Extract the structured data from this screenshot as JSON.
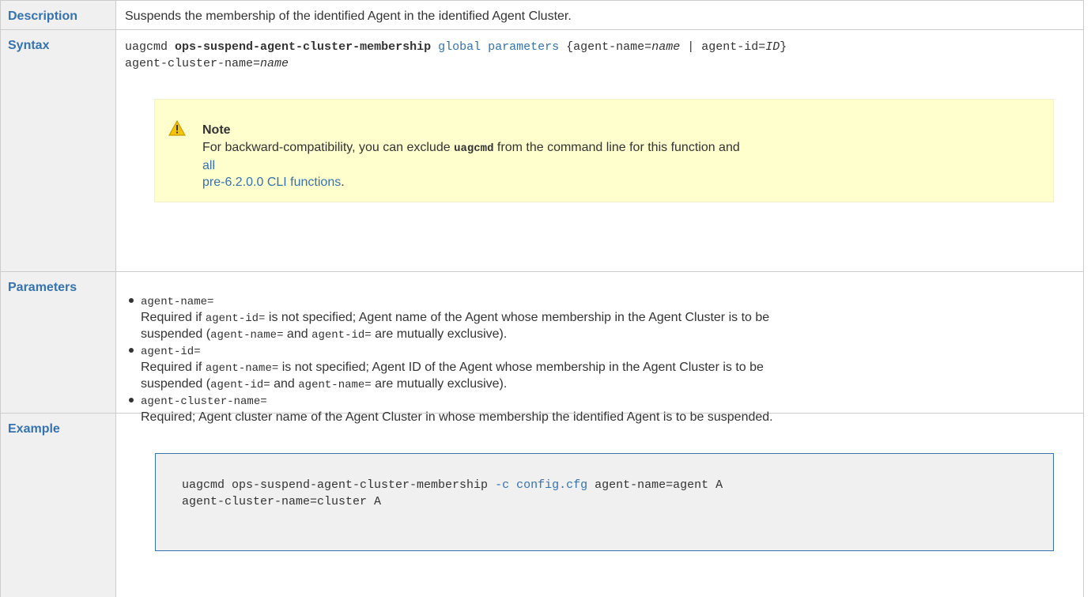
{
  "labels": {
    "description": "Description",
    "syntax": "Syntax",
    "parameters": "Parameters",
    "example": "Example"
  },
  "description": "Suspends the membership of the identified Agent in the identified Agent Cluster.",
  "syntax": {
    "cmd": "uagcmd",
    "function": "ops-suspend-agent-cluster-membership",
    "global_link": "global parameters",
    "brace_open": "{agent-name=",
    "name_italic": "name",
    "pipe": " | agent-id=",
    "id_italic": "ID",
    "brace_close": "}",
    "line2_prefix": "agent-cluster-name=",
    "line2_italic": "name"
  },
  "note": {
    "title": "Note",
    "text_before": "For backward-compatibility, you can exclude ",
    "uagcmd": "uagcmd",
    "text_middle": " from the command line for this function and ",
    "link_line1": "all",
    "link_line2": "pre-6.2.0.0 CLI functions",
    "period": "."
  },
  "parameters": [
    {
      "name": "agent-name=",
      "line1_start": "Required if ",
      "line1_code": "agent-id=",
      "line1_end": " is not specified; Agent name of the Agent whose membership in the Agent Cluster is to be",
      "line2_start": "suspended (",
      "line2_code1": "agent-name=",
      "line2_mid": " and ",
      "line2_code2": "agent-id=",
      "line2_end": " are mutually exclusive)."
    },
    {
      "name": "agent-id=",
      "line1_start": "Required if ",
      "line1_code": "agent-name=",
      "line1_end": " is not specified; Agent ID of the Agent whose membership in the Agent Cluster is to be",
      "line2_start": "suspended (",
      "line2_code1": "agent-id=",
      "line2_mid": " and ",
      "line2_code2": "agent-name=",
      "line2_end": " are mutually exclusive)."
    },
    {
      "name": "agent-cluster-name=",
      "line1_start": "Required; Agent cluster name of the Agent Cluster in whose membership the identified Agent is to be suspended.",
      "line1_code": "",
      "line1_end": "",
      "line2_start": "",
      "line2_code1": "",
      "line2_mid": "",
      "line2_code2": "",
      "line2_end": ""
    }
  ],
  "example": {
    "line1_start": "uagcmd ops-suspend-agent-cluster-membership ",
    "line1_flag": "-c",
    "line1_space": " ",
    "line1_file": "config.cfg",
    "line1_end": " agent-name=agent A",
    "line2": "agent-cluster-name=cluster A"
  },
  "colors": {
    "link": "#3572b0",
    "note_bg": "#ffffce",
    "label_bg": "#f0f0f0",
    "warning": "#f0b400"
  },
  "icons": {
    "note": "warning-icon"
  }
}
